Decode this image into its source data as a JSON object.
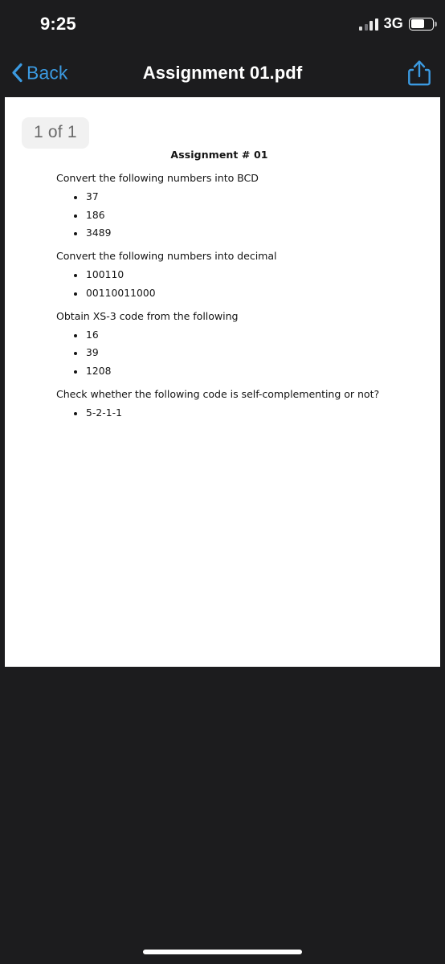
{
  "status_bar": {
    "time": "9:25",
    "carrier": "3G",
    "signal_icon": "signal-bars-icon",
    "battery_icon": "battery-icon",
    "battery_level_percent": 62
  },
  "nav_bar": {
    "back_label": "Back",
    "back_icon": "chevron-left-icon",
    "title": "Assignment 01.pdf",
    "share_icon": "share-icon",
    "accent_color": "#3b9ae1",
    "background_color": "#1c1c1e"
  },
  "viewer": {
    "page_badge": "1 of 1",
    "page_background": "#ffffff"
  },
  "document": {
    "title": "Assignment # 01",
    "sections": [
      {
        "heading": "Convert the following numbers into BCD",
        "items": [
          "37",
          "186",
          "3489"
        ]
      },
      {
        "heading": "Convert the following numbers into decimal",
        "items": [
          "100110",
          "00110011000"
        ]
      },
      {
        "heading": "Obtain XS-3 code from the following",
        "items": [
          "16",
          "39",
          "1208"
        ]
      },
      {
        "heading": "Check whether the following code is self-complementing or not?",
        "items": [
          "5-2-1-1"
        ]
      }
    ]
  },
  "home_indicator": {
    "label": "home-indicator"
  }
}
